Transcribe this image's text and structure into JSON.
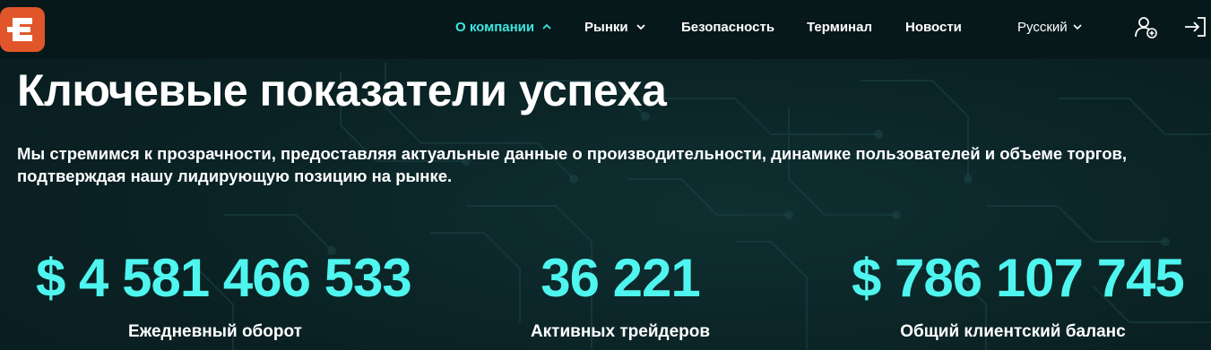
{
  "colors": {
    "accent": "#4ff5ef",
    "nav_active": "#3ee5df",
    "logo_bg": "#e0562a",
    "header_bg": "#07181a",
    "page_bg": "#0b2426"
  },
  "header": {
    "logo_icon": "exchange-logo-icon",
    "nav": [
      {
        "label": "О компании",
        "active": true,
        "has_dropdown": true
      },
      {
        "label": "Рынки",
        "active": false,
        "has_dropdown": true
      },
      {
        "label": "Безопасность",
        "active": false,
        "has_dropdown": false
      },
      {
        "label": "Терминал",
        "active": false,
        "has_dropdown": false
      },
      {
        "label": "Новости",
        "active": false,
        "has_dropdown": false
      }
    ],
    "language": "Русский",
    "register_icon": "user-plus-icon",
    "login_icon": "login-arrow-icon"
  },
  "main": {
    "title": "Ключевые показатели успеха",
    "description": "Мы стремимся к прозрачности, предоставляя актуальные данные о производительности, динамике пользователей и объеме торгов, подтверждая нашу лидирующую позицию на рынке.",
    "stats": [
      {
        "value": "$ 4 581 466 533",
        "label": "Ежедневный оборот"
      },
      {
        "value": "36 221",
        "label": "Активных трейдеров"
      },
      {
        "value": "$ 786 107 745",
        "label": "Общий клиентский баланс"
      }
    ]
  }
}
